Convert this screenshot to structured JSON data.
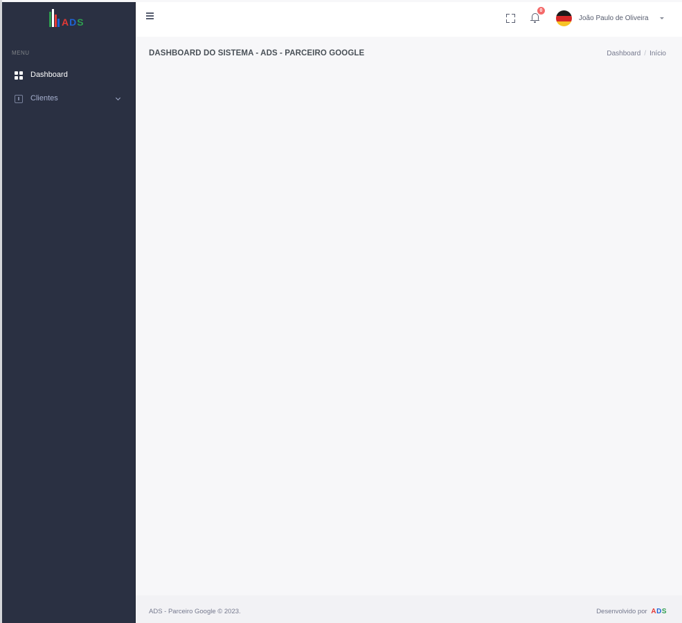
{
  "brand": {
    "logo_text": [
      "A",
      "D",
      "S"
    ],
    "colors": {
      "red": "#e53935",
      "blue": "#1e63d6",
      "green": "#2e9e4f",
      "white": "#ffffff"
    }
  },
  "sidebar": {
    "menu_title": "MENU",
    "items": [
      {
        "label": "Dashboard",
        "icon": "dashboard-icon",
        "active": true
      },
      {
        "label": "Clientes",
        "icon": "clients-icon",
        "has_submenu": true
      }
    ]
  },
  "topbar": {
    "notification_count": "0",
    "user_name": "João Paulo de Oliveira"
  },
  "page": {
    "title": "DASHBOARD DO SISTEMA - ADS - PARCEIRO GOOGLE",
    "breadcrumb": [
      "Dashboard",
      "Início"
    ]
  },
  "footer": {
    "copyright": "ADS - Parceiro Google © 2023.",
    "developed_by": "Desenvolvido por"
  },
  "theme": {
    "sidebar_bg": "#2a3042",
    "content_bg": "#f7f7f9",
    "badge_color": "#f46a6a"
  }
}
